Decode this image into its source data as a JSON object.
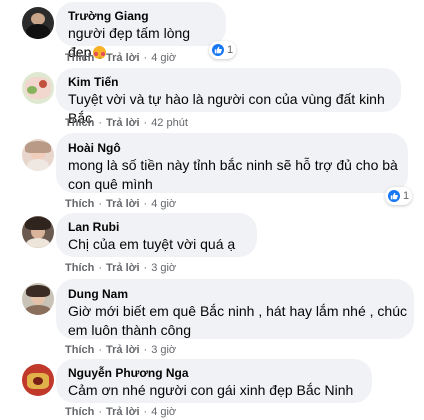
{
  "actions": {
    "like_label": "Thích",
    "reply_label": "Trả lời",
    "separator": "·"
  },
  "comments": [
    {
      "author": "Trường Giang",
      "text": "người đẹp tấm lòng đẹp",
      "emoji": "smiling-face-with-hearts",
      "time": "4 giờ",
      "reactions": "1"
    },
    {
      "author": "Kim Tiến",
      "text": "Tuyệt vời và tự hào là người con của vùng đất kinh Bắc",
      "time": "42 phút"
    },
    {
      "author": "Hoài Ngô",
      "text": "mong là số tiền này tỉnh bắc ninh sẽ hỗ trợ đủ cho bà con quê mình",
      "time": "4 giờ",
      "reactions": "1"
    },
    {
      "author": "Lan Rubi",
      "text": "Chị của em tuyệt vời quá ạ",
      "time": "3 giờ"
    },
    {
      "author": "Dung Nam",
      "text": "Giờ mới biết em quê Bắc ninh , hát hay lắm nhé , chúc em luôn thành công",
      "time": "3 giờ"
    },
    {
      "author": "Nguyễn Phương Nga",
      "text": "Cảm ơn nhé người con gái xinh đẹp Bắc Ninh",
      "time": "4 giờ"
    }
  ],
  "colors": {
    "bubble": "#f0f2f5",
    "meta": "#65676b",
    "like_blue": "#1877f2"
  }
}
